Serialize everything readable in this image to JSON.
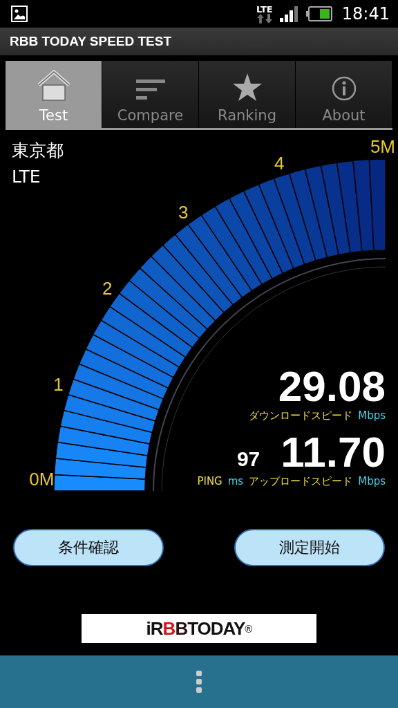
{
  "status_bar": {
    "network": "LTE",
    "time": "18:41"
  },
  "app_bar": {
    "title": "RBB TODAY SPEED TEST"
  },
  "tabs": [
    {
      "label": "Test",
      "kind": "home",
      "selected": true
    },
    {
      "label": "Compare",
      "kind": "list",
      "selected": false
    },
    {
      "label": "Ranking",
      "kind": "star",
      "selected": false
    },
    {
      "label": "About",
      "kind": "info",
      "selected": false
    }
  ],
  "location": {
    "region": "東京都",
    "network": "LTE"
  },
  "gauge": {
    "ticks": [
      "0M",
      "1",
      "2",
      "3",
      "4",
      "5M"
    ]
  },
  "download": {
    "value": "29.08",
    "label": "ダウンロードスピード",
    "unit": "Mbps"
  },
  "ping": {
    "value": "97",
    "label": "PING",
    "unit": "ms"
  },
  "upload": {
    "value": "11.70",
    "label": "アップロードスピード",
    "unit": "Mbps"
  },
  "buttons": [
    "条件確認",
    "測定開始"
  ],
  "logo": {
    "parts": [
      {
        "text": "iR",
        "color": "#111111"
      },
      {
        "text": "B",
        "color": "#d7141a"
      },
      {
        "text": "B",
        "color": "#2a1010"
      },
      {
        "text": "TODAY",
        "color": "#111111"
      },
      {
        "text": "®",
        "color": "#333333"
      }
    ]
  }
}
